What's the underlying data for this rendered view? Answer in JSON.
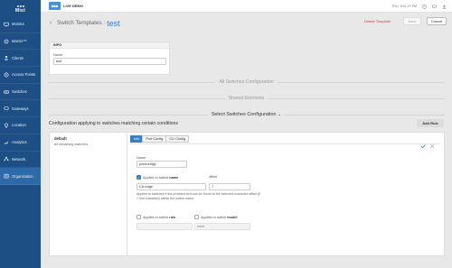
{
  "sidebar": {
    "logo": "Mist",
    "items": [
      {
        "label": "Monitor",
        "icon": "monitor-icon"
      },
      {
        "label": "Marvis™",
        "icon": "marvis-icon"
      },
      {
        "label": "Clients",
        "icon": "clients-icon"
      },
      {
        "label": "Access Points",
        "icon": "access-points-icon"
      },
      {
        "label": "Switches",
        "icon": "switches-icon"
      },
      {
        "label": "Gateways",
        "icon": "gateways-icon"
      },
      {
        "label": "Location",
        "icon": "location-icon"
      },
      {
        "label": "Analytics",
        "icon": "analytics-icon"
      },
      {
        "label": "Network",
        "icon": "network-icon"
      },
      {
        "label": "Organization",
        "icon": "organization-icon"
      }
    ],
    "active_index": 9
  },
  "topbar": {
    "org_name": "LIVE DEMO",
    "time": "THU, 8:51:27 PM"
  },
  "header": {
    "breadcrumb": "Switch Templates :",
    "template_name": "test",
    "delete_label": "Delete Template",
    "save_label": "Save",
    "cancel_label": "Cancel"
  },
  "info": {
    "title": "INFO",
    "name_label": "Name",
    "name_value": "test"
  },
  "sections": {
    "all_switches": "All Switches Configuration",
    "shared": "Shared Elements",
    "select_switches": "Select Switches Configuration"
  },
  "config": {
    "heading": "Configuration applying to switches matching certain conditions",
    "add_rule_label": "Add Rule",
    "rules": [
      {
        "name": "default",
        "desc": "all remaining switches"
      }
    ],
    "tabs": [
      "Info",
      "Port Config",
      "CLI Config"
    ],
    "active_tab": 0,
    "name_label": "Name",
    "name_value": "portconfig1",
    "applies_name_prefix": "Applies to switch",
    "applies_name_bold": "name",
    "applies_name_checked": true,
    "offset_label": "offset",
    "name_match_value": "CA-edge",
    "offset_value": "7",
    "help_text": "Applies to switches if the provided text can be found at the selected character offset (0 = first character) within the switch name",
    "applies_role_prefix": "Applies to switch",
    "applies_role_bold": "role",
    "applies_model_prefix": "Applies to switch",
    "applies_model_bold": "model",
    "model_value": "none"
  },
  "colors": {
    "sidebar": "#1e4f84",
    "sidebar_active": "#2f6aa8",
    "accent": "#3a7dc4",
    "danger": "#d23b3b"
  }
}
